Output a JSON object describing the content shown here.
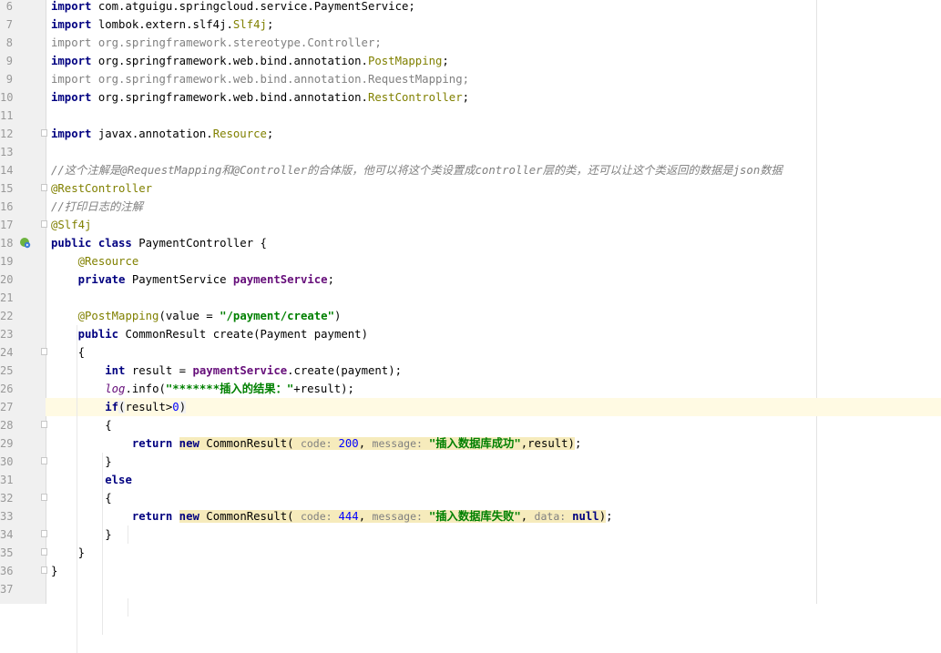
{
  "editor": {
    "lines": [
      {
        "n": "6",
        "segs": [
          {
            "c": "kw",
            "t": "import "
          },
          {
            "c": "",
            "t": "com.atguigu.springcloud.service.PaymentService;"
          }
        ]
      },
      {
        "n": "7",
        "segs": [
          {
            "c": "kw",
            "t": "import "
          },
          {
            "c": "",
            "t": "lombok.extern.slf4j."
          },
          {
            "c": "ann",
            "t": "Slf4j"
          },
          {
            "c": "",
            "t": ";"
          }
        ]
      },
      {
        "n": "8",
        "segs": [
          {
            "c": "dim",
            "t": "import org.springframework.stereotype.Controller;"
          }
        ]
      },
      {
        "n": "9",
        "segs": [
          {
            "c": "kw",
            "t": "import "
          },
          {
            "c": "",
            "t": "org.springframework.web.bind.annotation."
          },
          {
            "c": "ann",
            "t": "PostMapping"
          },
          {
            "c": "",
            "t": ";"
          }
        ]
      },
      {
        "n": "9",
        "segs": [
          {
            "c": "dim",
            "t": "import org.springframework.web.bind.annotation.RequestMapping;"
          }
        ]
      },
      {
        "n": "10",
        "segs": [
          {
            "c": "kw",
            "t": "import "
          },
          {
            "c": "",
            "t": "org.springframework.web.bind.annotation."
          },
          {
            "c": "ann",
            "t": "RestController"
          },
          {
            "c": "",
            "t": ";"
          }
        ]
      },
      {
        "n": "11",
        "segs": []
      },
      {
        "n": "12",
        "segs": [
          {
            "c": "kw",
            "t": "import "
          },
          {
            "c": "",
            "t": "javax.annotation."
          },
          {
            "c": "ann",
            "t": "Resource"
          },
          {
            "c": "",
            "t": ";"
          }
        ]
      },
      {
        "n": "13",
        "segs": []
      },
      {
        "n": "14",
        "segs": [
          {
            "c": "cmt",
            "t": "//这个注解是@RequestMapping和@Controller的合体版，他可以将这个类设置成controller层的类，还可以让这个类返回的数据是json数据"
          }
        ]
      },
      {
        "n": "15",
        "segs": [
          {
            "c": "ann",
            "t": "@RestController"
          }
        ]
      },
      {
        "n": "16",
        "segs": [
          {
            "c": "cmt",
            "t": "//打印日志的注解"
          }
        ]
      },
      {
        "n": "17",
        "segs": [
          {
            "c": "ann",
            "t": "@Slf4j"
          }
        ]
      },
      {
        "n": "18",
        "segs": [
          {
            "c": "kw",
            "t": "public class "
          },
          {
            "c": "",
            "t": "PaymentController {"
          }
        ]
      },
      {
        "n": "19",
        "segs": [
          {
            "c": "",
            "t": "    "
          },
          {
            "c": "ann",
            "t": "@Resource"
          }
        ]
      },
      {
        "n": "20",
        "segs": [
          {
            "c": "",
            "t": "    "
          },
          {
            "c": "kw",
            "t": "private "
          },
          {
            "c": "",
            "t": "PaymentService "
          },
          {
            "c": "fld",
            "t": "paymentService"
          },
          {
            "c": "",
            "t": ";"
          }
        ]
      },
      {
        "n": "21",
        "segs": []
      },
      {
        "n": "22",
        "segs": [
          {
            "c": "",
            "t": "    "
          },
          {
            "c": "ann",
            "t": "@PostMapping"
          },
          {
            "c": "",
            "t": "(value = "
          },
          {
            "c": "str",
            "t": "\"/payment/create\""
          },
          {
            "c": "",
            "t": ")"
          }
        ]
      },
      {
        "n": "23",
        "segs": [
          {
            "c": "",
            "t": "    "
          },
          {
            "c": "kw",
            "t": "public "
          },
          {
            "c": "",
            "t": "CommonResult create(Payment payment)"
          }
        ]
      },
      {
        "n": "24",
        "segs": [
          {
            "c": "",
            "t": "    {"
          }
        ]
      },
      {
        "n": "25",
        "segs": [
          {
            "c": "",
            "t": "        "
          },
          {
            "c": "kw",
            "t": "int "
          },
          {
            "c": "",
            "t": "result = "
          },
          {
            "c": "fld",
            "t": "paymentService"
          },
          {
            "c": "",
            "t": ".create(payment);"
          }
        ]
      },
      {
        "n": "26",
        "segs": [
          {
            "c": "",
            "t": "        "
          },
          {
            "c": "stat",
            "t": "log"
          },
          {
            "c": "",
            "t": ".info("
          },
          {
            "c": "str",
            "t": "\"*******插入的结果：\""
          },
          {
            "c": "",
            "t": "+result);"
          }
        ]
      },
      {
        "n": "27",
        "segs": [
          {
            "c": "",
            "t": "        "
          },
          {
            "c": "kw",
            "t": "if"
          },
          {
            "c": "mark",
            "t": "("
          },
          {
            "c": "",
            "t": "result>"
          },
          {
            "c": "num",
            "t": "0"
          },
          {
            "c": "mark",
            "t": ")"
          }
        ]
      },
      {
        "n": "28",
        "segs": [
          {
            "c": "",
            "t": "        {"
          }
        ]
      },
      {
        "n": "29",
        "segs": [
          {
            "c": "",
            "t": "            "
          },
          {
            "c": "kw",
            "t": "return "
          },
          {
            "c": "kw hl",
            "t": "new "
          },
          {
            "c": "hl",
            "t": "CommonResult( "
          },
          {
            "c": "hint hl",
            "t": "code: "
          },
          {
            "c": "num hl",
            "t": "200"
          },
          {
            "c": "hl",
            "t": ", "
          },
          {
            "c": "hint hl",
            "t": "message: "
          },
          {
            "c": "str hl",
            "t": "\"插入数据库成功\""
          },
          {
            "c": "hl",
            "t": ",result)"
          },
          {
            "c": "",
            "t": ";"
          }
        ]
      },
      {
        "n": "30",
        "segs": [
          {
            "c": "",
            "t": "        }"
          }
        ]
      },
      {
        "n": "31",
        "segs": [
          {
            "c": "",
            "t": "        "
          },
          {
            "c": "kw",
            "t": "else"
          }
        ]
      },
      {
        "n": "32",
        "segs": [
          {
            "c": "",
            "t": "        {"
          }
        ]
      },
      {
        "n": "33",
        "segs": [
          {
            "c": "",
            "t": "            "
          },
          {
            "c": "kw",
            "t": "return "
          },
          {
            "c": "kw hl",
            "t": "new "
          },
          {
            "c": "hl",
            "t": "CommonResult( "
          },
          {
            "c": "hint hl",
            "t": "code: "
          },
          {
            "c": "num hl",
            "t": "444"
          },
          {
            "c": "hl",
            "t": ", "
          },
          {
            "c": "hint hl",
            "t": "message: "
          },
          {
            "c": "str hl",
            "t": "\"插入数据库失败\""
          },
          {
            "c": "hl",
            "t": ", "
          },
          {
            "c": "hint hl",
            "t": "data: "
          },
          {
            "c": "kw hl",
            "t": "null"
          },
          {
            "c": "hl",
            "t": ")"
          },
          {
            "c": "",
            "t": ";"
          }
        ]
      },
      {
        "n": "34",
        "segs": [
          {
            "c": "",
            "t": "        }"
          }
        ]
      },
      {
        "n": "35",
        "segs": [
          {
            "c": "",
            "t": "    }"
          }
        ]
      },
      {
        "n": "36",
        "segs": [
          {
            "c": "",
            "t": "}"
          }
        ]
      },
      {
        "n": "37",
        "segs": []
      }
    ],
    "caret_line": "27",
    "fold_markers": [
      "12",
      "15",
      "17",
      "24",
      "28",
      "30",
      "32",
      "34",
      "35",
      "36"
    ],
    "run_icon_line": "18",
    "icons": {
      "run": "spring-bean-run-icon",
      "fold": "fold-marker-icon"
    },
    "colors": {
      "keyword": "#000080",
      "annotation": "#808000",
      "string": "#008000",
      "number": "#0000ff",
      "comment": "#808080",
      "field": "#660e7a",
      "caret_row": "#fffae3",
      "param_hint_bg": "#f6ebbc"
    }
  }
}
